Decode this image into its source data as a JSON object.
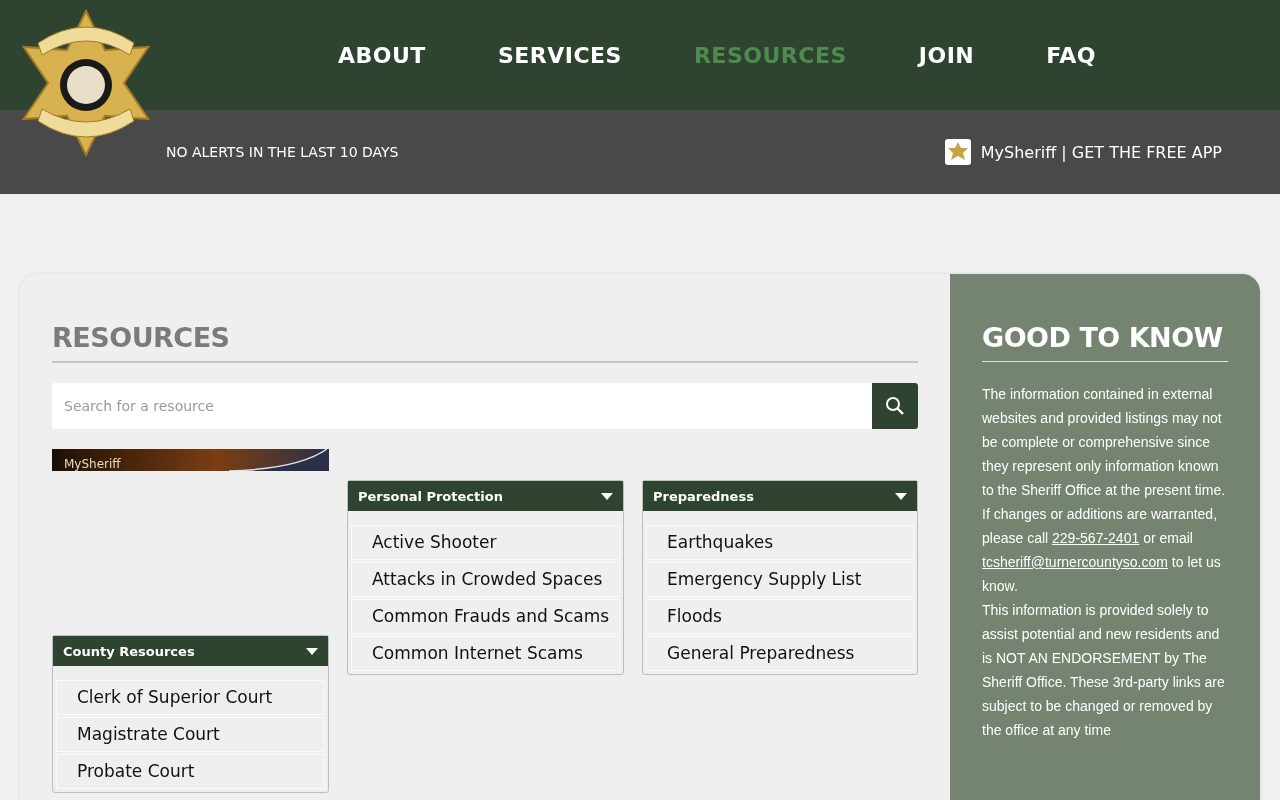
{
  "nav": [
    {
      "label": "ABOUT",
      "selected": false
    },
    {
      "label": "SERVICES",
      "selected": false
    },
    {
      "label": "RESOURCES",
      "selected": true
    },
    {
      "label": "JOIN",
      "selected": false
    },
    {
      "label": "FAQ",
      "selected": false
    }
  ],
  "alert": "NO ALERTS IN THE LAST 10 DAYS",
  "app_link": "MySheriff | GET THE FREE APP",
  "resources": {
    "title": "RESOURCES",
    "search": {
      "placeholder": "Search for a resource"
    },
    "banner": {
      "label": "MySheriff"
    },
    "groups": [
      {
        "title": "County Resources",
        "expanded": true,
        "items": [
          "Clerk of Superior Court",
          "Magistrate Court",
          "Probate Court"
        ]
      },
      {
        "title": "Personal Protection",
        "expanded": true,
        "items": [
          "Active Shooter",
          "Attacks in Crowded Spaces",
          "Common Frauds and Scams",
          "Common Internet Scams"
        ]
      },
      {
        "title": "Preparedness",
        "expanded": true,
        "items": [
          "Earthquakes",
          "Emergency Supply List",
          "Floods",
          "General Preparedness"
        ]
      }
    ]
  },
  "good_to_know": {
    "title": "GOOD TO KNOW",
    "paragraph_1": "The information contained in external websites and provided listings may not be complete or comprehensive since they represent only information known to the Sheriff Office at the present time.",
    "paragraph_2": {
      "before": "If changes or additions are warranted, please call",
      "phone": "229-567-2401",
      "middle": "or email",
      "email": "tcsheriff@turnercountyso.com",
      "after": "to let us know."
    },
    "paragraph_3": "This information is provided solely to assist potential and new residents and is NOT AN ENDORSEMENT by The Sheriff Office. These 3rd-party links are subject to be changed or removed by the office at any time"
  }
}
